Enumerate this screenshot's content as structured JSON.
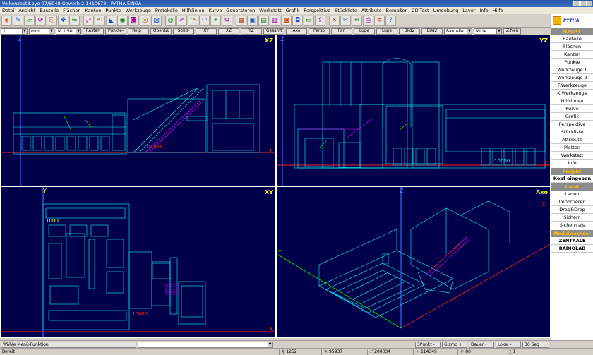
{
  "title": {
    "text": "Volkonzept3.pyo   07/6048 Gewerb    2-1410678 - PYTHA EINGA"
  },
  "menu": [
    "Datei",
    "Ansicht",
    "Bauteile",
    "Flächen",
    "Kanten",
    "Punkte",
    "Werkzeuge",
    "Protokolle",
    "Hilfslinien",
    "Kurve",
    "Generatoren",
    "Werkstatt",
    "Grafik",
    "Perspektive",
    "Stückliste",
    "Attribute",
    "Bemaßen",
    "2D-Text",
    "Umgebung",
    "Layer",
    "Info",
    "Hilfe"
  ],
  "toolbar_icons": [
    "open-icon",
    "draw-icon",
    "extrude-icon",
    "rotate-icon",
    "copy-icon",
    "move-icon",
    "mirror-icon",
    "scale-icon",
    "undo-icon",
    "edge-icon",
    "render-icon",
    "camera-icon",
    "eye-icon",
    "paint-icon",
    "bucket-icon",
    "brush-icon",
    "redo-icon",
    "arc-icon",
    "reference-icon",
    "settings-icon",
    "grid-icon",
    "window-icon",
    "layer-icon",
    "table-icon",
    "pattern-icon",
    "shade-icon",
    "clipboard-icon",
    "export-icon",
    "delete-icon",
    "cut-icon",
    "stretch-icon",
    "print-icon",
    "list-icon",
    "help-icon"
  ],
  "toolbar2": {
    "layer_value": "1",
    "unit_value": "mm",
    "scale_value": "M 1:50",
    "buttons": [
      "Raster-",
      "Punkte-",
      "Relp+",
      "Open&L",
      "Solid-",
      "XY",
      "XZ",
      "YZ",
      "Gesamt",
      "Axo",
      "Persp",
      "Pan",
      "Lupe",
      "Lupe",
      "Bild2",
      "Bild2"
    ],
    "select_bauteile": "Bauteile",
    "select_mitte": "Mitte",
    "z_neu": "Z.Neu"
  },
  "viewports": {
    "xz": {
      "label": "XZ",
      "axis_v": "Z",
      "axis_h": "X",
      "dim": "10000"
    },
    "yz": {
      "label": "YZ",
      "axis_v": "Z",
      "axis_h": "X",
      "dim": "10000"
    },
    "xy": {
      "label": "XY",
      "axis_v": "Y",
      "axis_h": "X",
      "dim1": "10000",
      "dim2": "10000"
    },
    "axo": {
      "label": "Axo",
      "axis_v": "Z",
      "axis_h": "X",
      "axis_y": "Y"
    }
  },
  "right_panel": {
    "logo_text": "PYTHA",
    "sections": [
      {
        "head": "HAUPT",
        "items": [
          "Bauteile",
          "Flächen",
          "Kanten",
          "Punkte",
          "Werkzeuge 1",
          "Werkzeuge 2",
          "F.Werkzeuge",
          "K.Werkzeuge",
          "Hilfslinien",
          "Kurve",
          "Grafik",
          "Perspektive",
          "Stückliste",
          "Attribute",
          "Plotten",
          "Werkstatt",
          "Info"
        ]
      },
      {
        "head": "Projekt",
        "items": [
          "Kopf eingeben"
        ]
      },
      {
        "head": "Datei",
        "items": [
          "Laden",
          "Importieren",
          "Drag&Drop",
          "Sichern",
          "Sichern als"
        ]
      },
      {
        "head": "Modulwechsel",
        "items": [
          "ZENTRALE",
          "RADIOLAB"
        ]
      }
    ]
  },
  "command_bar": {
    "prompt": "Wähle Menü-Funktion",
    "input_value": "",
    "fields": [
      "3Punkt -",
      "Gizmo +",
      "Dauer -",
      "Lokal -",
      "36 Seg"
    ]
  },
  "status_bar": {
    "status": "Bereit",
    "values": [
      "1252",
      "95937",
      "200034",
      "114349",
      "80",
      "1"
    ]
  },
  "colors": {
    "viewport_bg": "#00004a",
    "geometry": "#00ffff",
    "selection": "#ff00ff",
    "axis_z": "#4080ff",
    "axis_x": "#ff2020",
    "label": "#ffff00",
    "panel_head": "#ffc000"
  }
}
